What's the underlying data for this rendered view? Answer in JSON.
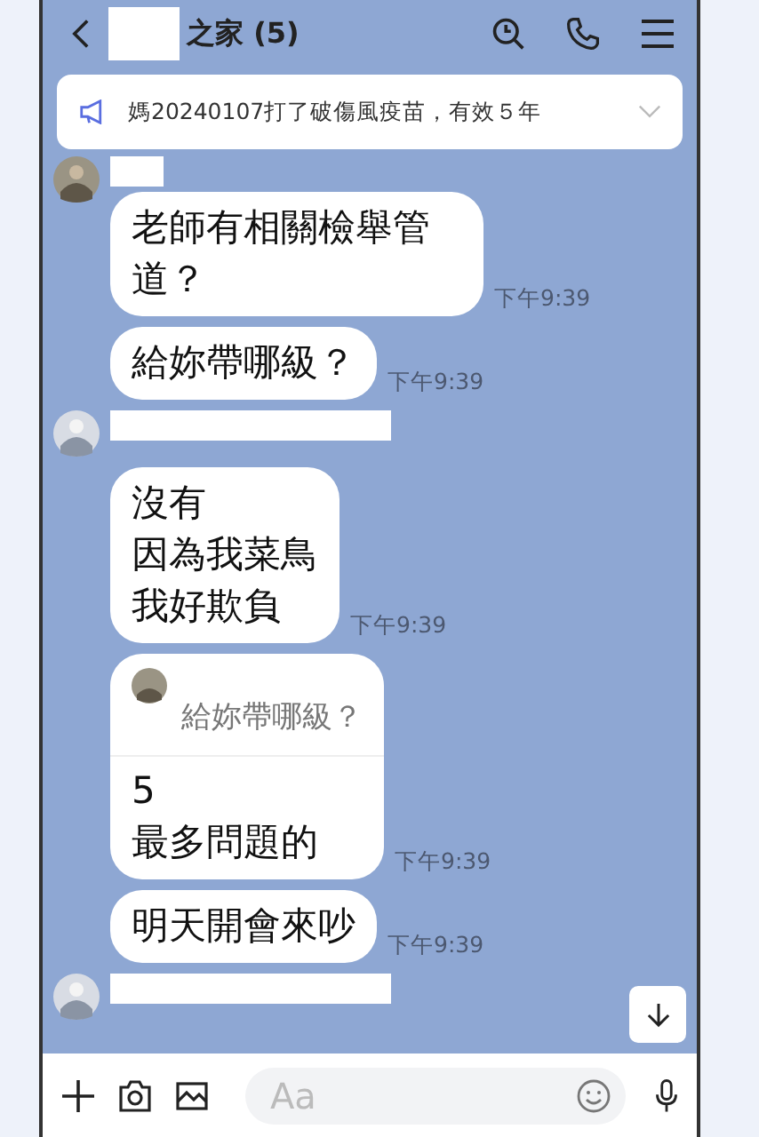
{
  "header": {
    "title": "之家 (5)"
  },
  "announcement": {
    "text": "媽20240107打了破傷風疫苗，有效５年"
  },
  "messages": [
    {
      "kind": "sender"
    },
    {
      "kind": "text",
      "lines": [
        "老師有相關檢舉管道？"
      ],
      "time": "下午9:39"
    },
    {
      "kind": "text",
      "lines": [
        "給妳帶哪級？"
      ],
      "time": "下午9:39"
    },
    {
      "kind": "sender"
    },
    {
      "kind": "text",
      "lines": [
        "沒有",
        "因為我菜鳥",
        "我好欺負"
      ],
      "time": "下午9:39"
    },
    {
      "kind": "reply",
      "quote": "給妳帶哪級？",
      "lines": [
        "5",
        "最多問題的"
      ],
      "time": "下午9:39"
    },
    {
      "kind": "text",
      "lines": [
        "明天開會來吵"
      ],
      "time": "下午9:39"
    },
    {
      "kind": "sender"
    }
  ],
  "input": {
    "placeholder": "Aa"
  }
}
